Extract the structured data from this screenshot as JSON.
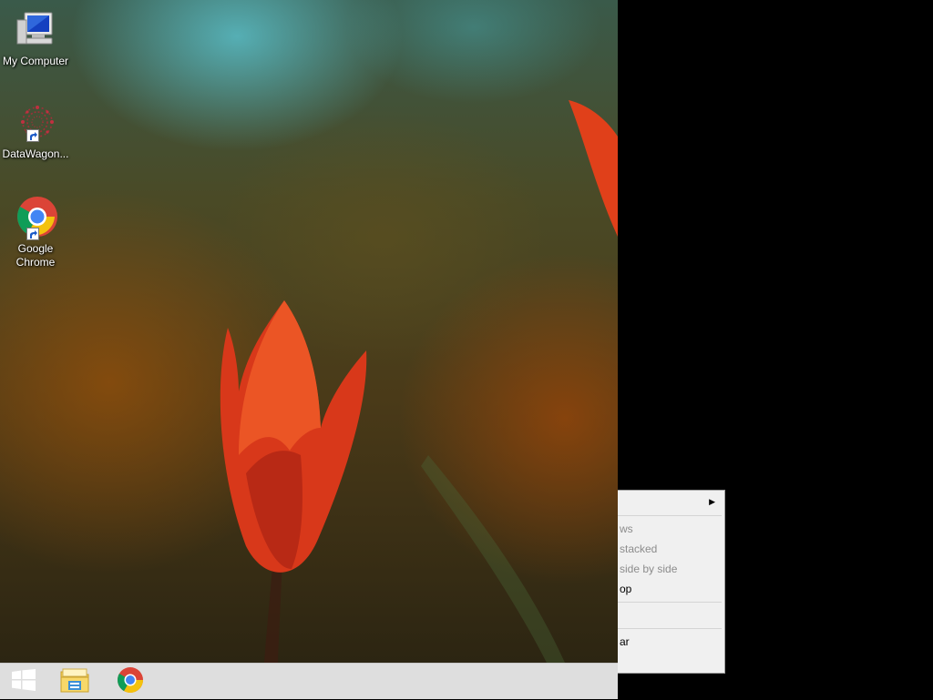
{
  "desktop": {
    "icons": [
      {
        "label": "My Computer",
        "icon": "computer-icon"
      },
      {
        "label": "DataWagon...",
        "icon": "datawagon-icon"
      },
      {
        "label": "Google\nChrome",
        "icon": "chrome-icon"
      }
    ]
  },
  "taskbar": {
    "items": [
      {
        "icon": "windows-start-icon"
      },
      {
        "icon": "file-explorer-icon"
      },
      {
        "icon": "chrome-icon"
      }
    ]
  },
  "context_menu": {
    "items": [
      {
        "label": "",
        "has_submenu": true,
        "enabled": true
      },
      {
        "label": "ws",
        "enabled": false
      },
      {
        "label": "stacked",
        "enabled": false
      },
      {
        "label": "side by side",
        "enabled": false
      },
      {
        "label": "op",
        "enabled": true
      },
      {
        "label": "",
        "enabled": true
      },
      {
        "label": "ar",
        "enabled": true
      }
    ],
    "separator_color": "#d4d4d4"
  },
  "colors": {
    "taskbar": "#dedede",
    "menu_bg": "#f0f0f0",
    "disabled_text": "#8c8c8c",
    "tulip": "#e8401a"
  }
}
